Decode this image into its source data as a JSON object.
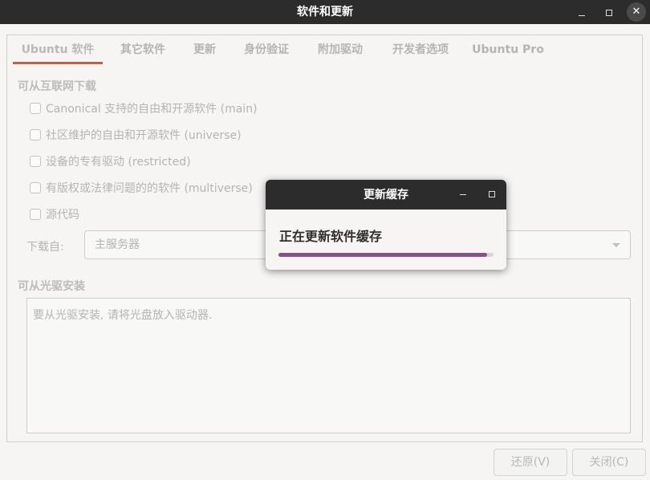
{
  "window": {
    "title": "软件和更新"
  },
  "tabs": [
    {
      "label": "Ubuntu 软件",
      "active": true
    },
    {
      "label": "其它软件"
    },
    {
      "label": "更新"
    },
    {
      "label": "身份验证"
    },
    {
      "label": "附加驱动"
    },
    {
      "label": "开发者选项"
    },
    {
      "label": "Ubuntu Pro"
    }
  ],
  "internet": {
    "section_title": "可从互联网下载",
    "options": [
      {
        "label": "Canonical 支持的自由和开源软件 (main)",
        "checked": false
      },
      {
        "label": "社区维护的自由和开源软件 (universe)",
        "checked": false
      },
      {
        "label": "设备的专有驱动 (restricted)",
        "checked": false
      },
      {
        "label": "有版权或法律问题的的软件 (multiverse)",
        "checked": false
      },
      {
        "label": "源代码",
        "checked": false
      }
    ],
    "download_from_label": "下载自:",
    "download_from_value": "主服务器"
  },
  "cdrom": {
    "section_title": "可从光驱安装",
    "hint": "要从光驱安装, 请将光盘放入驱动器."
  },
  "buttons": {
    "revert": "还原(V)",
    "close": "关闭(C)"
  },
  "dialog": {
    "title": "更新缓存",
    "message": "正在更新软件缓存",
    "progress": 0.97,
    "progress_color": "#8a4f8d"
  },
  "colors": {
    "accent": "#e95420",
    "titlebar": "#2c2c2c"
  }
}
